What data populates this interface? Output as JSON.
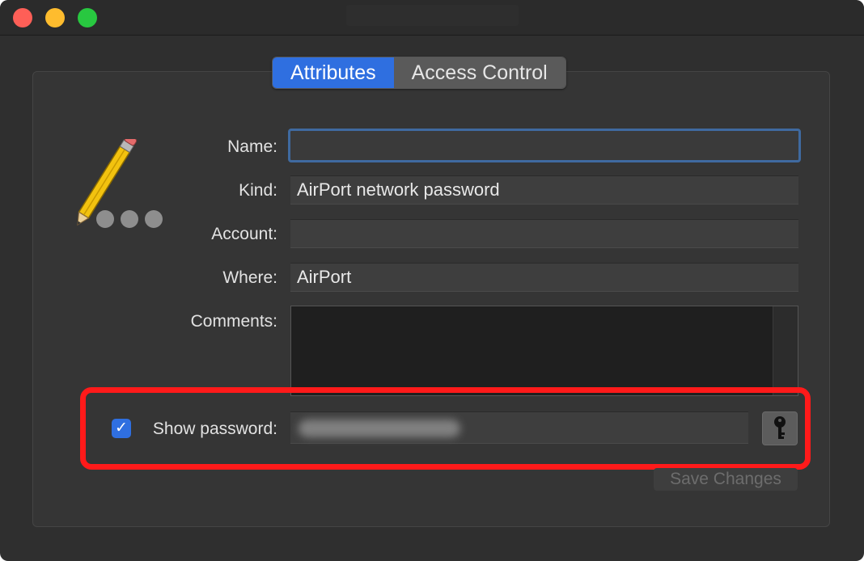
{
  "window": {
    "title": ""
  },
  "tabs": [
    {
      "label": "Attributes",
      "active": true
    },
    {
      "label": "Access Control",
      "active": false
    }
  ],
  "fields": {
    "name": {
      "label": "Name:",
      "value": ""
    },
    "kind": {
      "label": "Kind:",
      "value": "AirPort network password"
    },
    "account": {
      "label": "Account:",
      "value": ""
    },
    "where": {
      "label": "Where:",
      "value": "AirPort"
    },
    "comments": {
      "label": "Comments:",
      "value": ""
    }
  },
  "show_password": {
    "label": "Show password:",
    "checked": true,
    "checkmark": "✓"
  },
  "buttons": {
    "save": "Save Changes"
  },
  "icons": {
    "pencil": "pencil-icon",
    "key": "key-icon"
  },
  "colors": {
    "accent": "#2f6fe0",
    "highlight": "#ff1a1a",
    "close": "#fe5f57",
    "minimize": "#febc2e",
    "maximize": "#28c840"
  }
}
